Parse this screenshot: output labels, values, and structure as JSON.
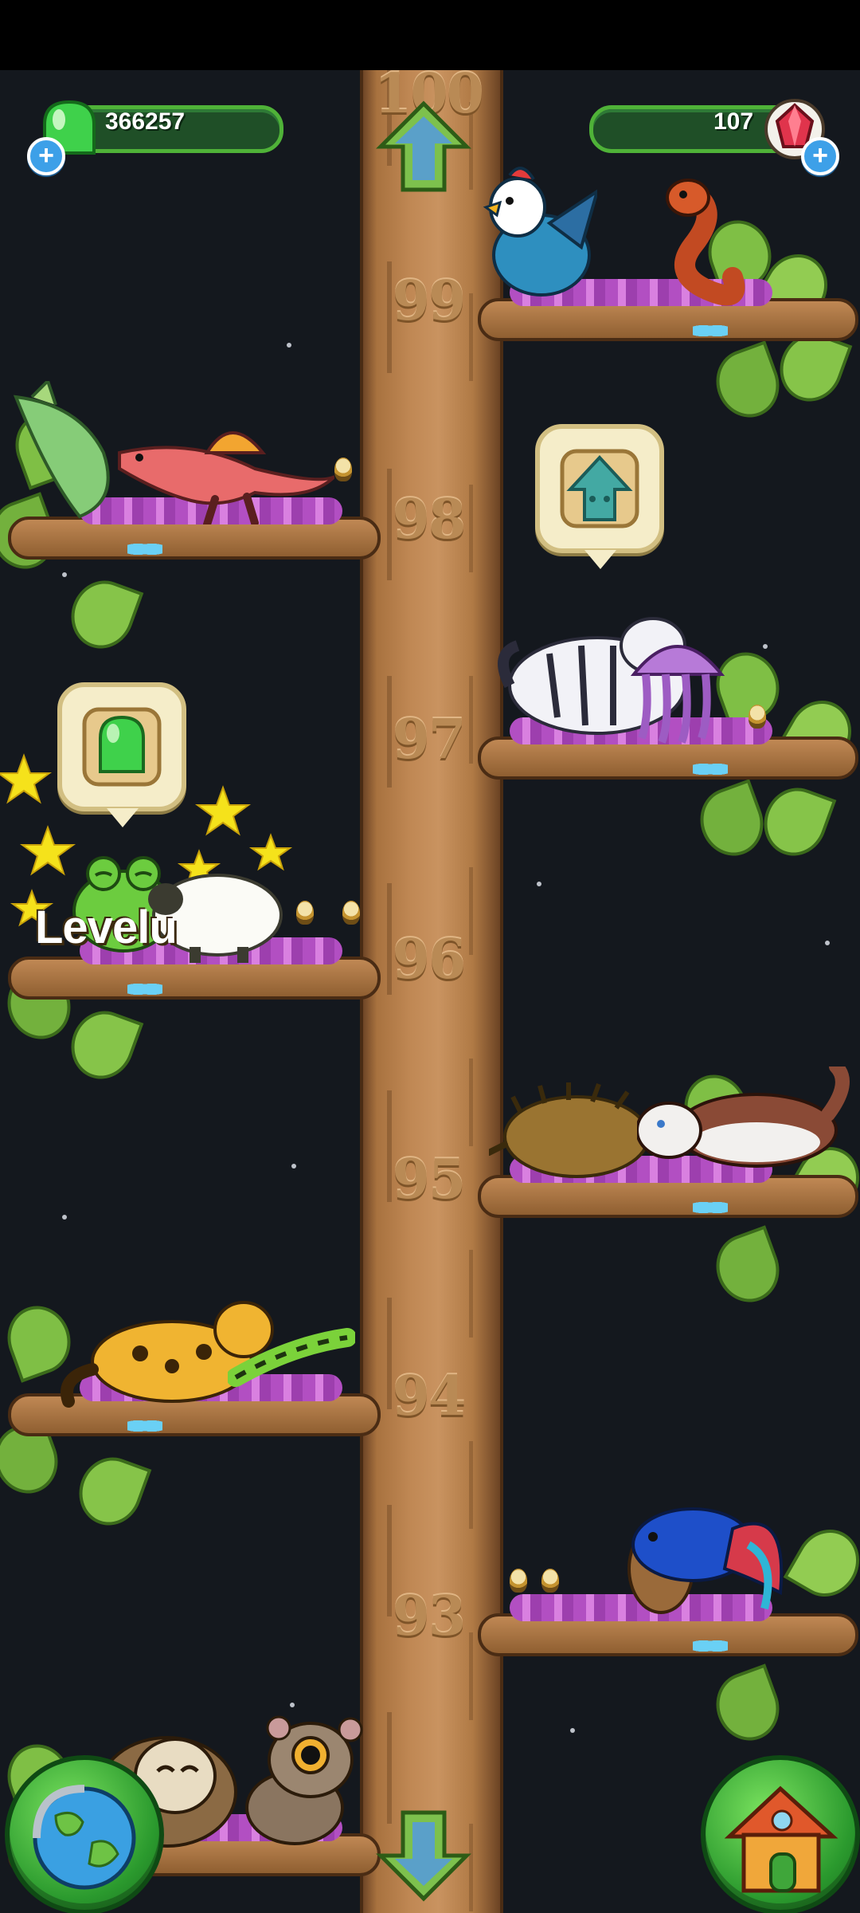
{
  "hud": {
    "jelly_count": "366257",
    "gem_count": "107",
    "colors": {
      "jelly": "#3fd14b",
      "gem": "#e0344c",
      "panel": "#1f4f27",
      "panel_border": "#4fb238"
    }
  },
  "tree": {
    "levels": [
      "100",
      "99",
      "98",
      "97",
      "96",
      "95",
      "94",
      "93"
    ]
  },
  "floating_text": {
    "level_up": "Levelu"
  },
  "icons": {
    "hud_left": "green-jelly-icon",
    "hud_right": "red-gem-icon",
    "scroll_up": "up-arrow-icon",
    "scroll_down": "down-arrow-icon",
    "world_map": "globe-icon",
    "home": "house-icon",
    "upgrade_bubble": "upgrade-arrow-icon",
    "jelly_bubble": "jelly-drop-icon"
  },
  "creatures": {
    "99": [
      "rooster-dragon",
      "red-eel"
    ],
    "98": [
      "green-moth",
      "pink-spinosaurus"
    ],
    "97": [
      "white-tiger",
      "purple-jellyfish"
    ],
    "96": [
      "green-frog",
      "white-sheep"
    ],
    "95": [
      "brown-echidna",
      "husky"
    ],
    "94": [
      "clouded-leopard",
      "green-caterpillar"
    ],
    "93": [
      "bushbaby",
      "betta-fish"
    ],
    "92": [
      "slow-loris",
      "tarsier"
    ]
  }
}
